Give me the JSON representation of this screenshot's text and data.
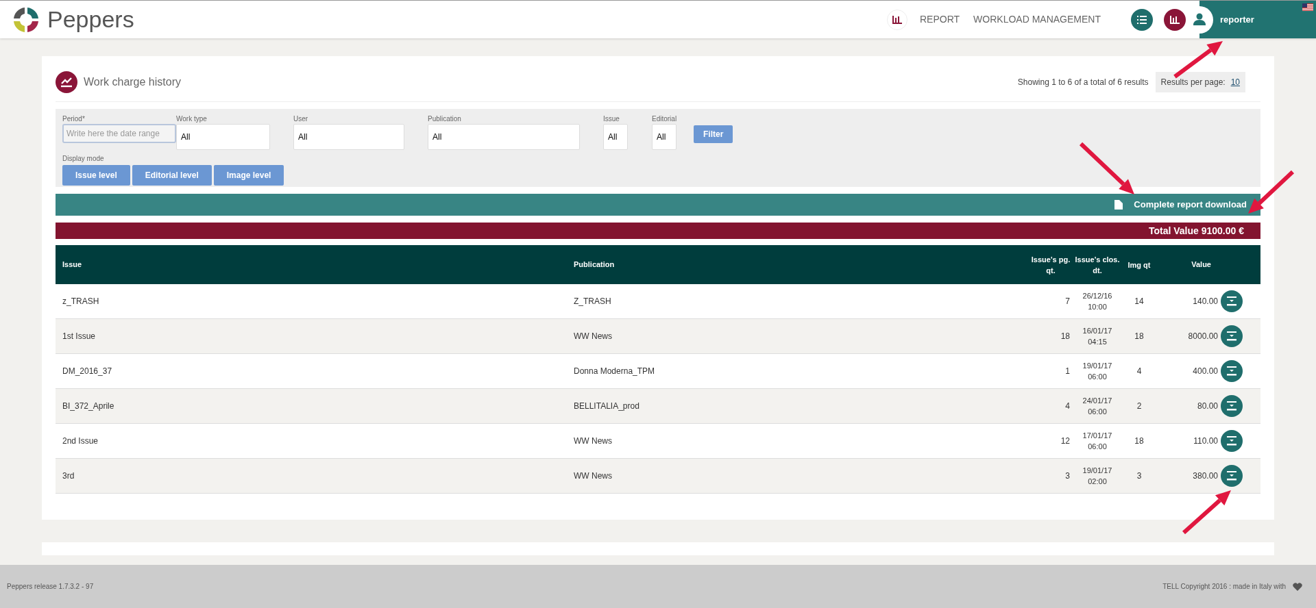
{
  "app": {
    "name": "Peppers"
  },
  "nav": {
    "items": [
      "REPORT",
      "WORKLOAD MANAGEMENT"
    ],
    "user": "reporter"
  },
  "card": {
    "title": "Work charge history",
    "results_info": "Showing 1 to 6 of a total of 6 results",
    "per_page_label": "Results per page:",
    "per_page_value": "10"
  },
  "filters": [
    {
      "label": "Period*",
      "placeholder": "Write here the date range",
      "kind": "placeholder"
    },
    {
      "label": "Work type",
      "value": "All",
      "kind": "value"
    },
    {
      "label": "User",
      "value": "All",
      "kind": "value"
    },
    {
      "label": "Publication",
      "value": "All",
      "kind": "value"
    },
    {
      "label": "Issue",
      "value": "All",
      "kind": "value"
    },
    {
      "label": "Editorial",
      "value": "All",
      "kind": "value"
    }
  ],
  "filter_button": "Filter",
  "display_mode": {
    "label": "Display mode",
    "buttons": [
      "Issue level",
      "Editorial level",
      "Image level"
    ]
  },
  "download": "Complete report download",
  "total": "Total Value 9100.00 €",
  "table": {
    "columns": [
      "Issue",
      "Publication",
      "Issue's pg. qt.",
      "Issue's clos. dt.",
      "Img qt",
      "Value"
    ],
    "rows": [
      {
        "issue": "z_TRASH",
        "publication": "Z_TRASH",
        "pages": "7",
        "date": "26/12/16",
        "time": "10:00",
        "images": "14",
        "value": "140.00"
      },
      {
        "issue": "1st Issue",
        "publication": "WW News",
        "pages": "18",
        "date": "16/01/17",
        "time": "04:15",
        "images": "18",
        "value": "8000.00"
      },
      {
        "issue": "DM_2016_37",
        "publication": "Donna Moderna_TPM",
        "pages": "1",
        "date": "19/01/17",
        "time": "06:00",
        "images": "4",
        "value": "400.00"
      },
      {
        "issue": "BI_372_Aprile",
        "publication": "BELLITALIA_prod",
        "pages": "4",
        "date": "24/01/17",
        "time": "06:00",
        "images": "2",
        "value": "80.00"
      },
      {
        "issue": "2nd Issue",
        "publication": "WW News",
        "pages": "12",
        "date": "17/01/17",
        "time": "06:00",
        "images": "18",
        "value": "110.00"
      },
      {
        "issue": "3rd",
        "publication": "WW News",
        "pages": "3",
        "date": "19/01/17",
        "time": "02:00",
        "images": "3",
        "value": "380.00"
      }
    ]
  },
  "footer": {
    "release": "Peppers release 1.7.3.2 - 97",
    "copyright": "TELL Copyright 2016 : made in Italy with"
  }
}
